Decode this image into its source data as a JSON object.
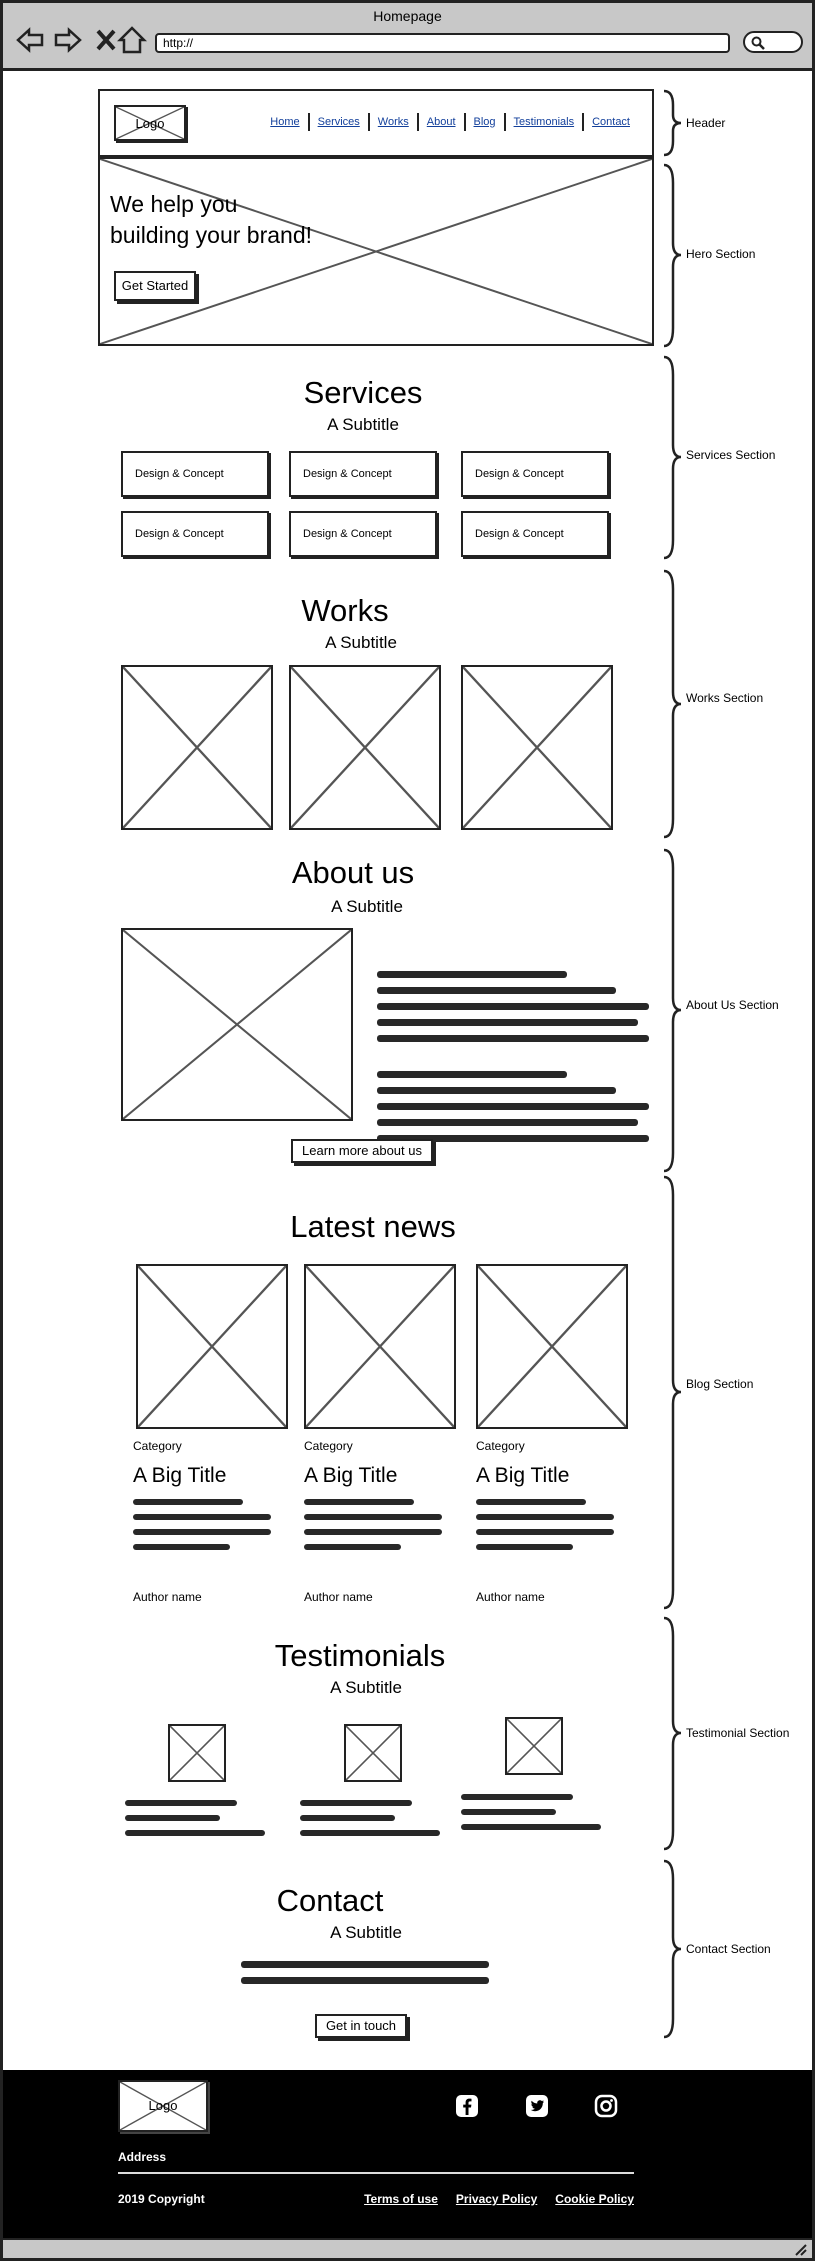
{
  "browser": {
    "title": "Homepage",
    "url": "http://"
  },
  "header": {
    "logo": "Logo",
    "nav": [
      "Home",
      "Services",
      "Works",
      "About",
      "Blog",
      "Testimonials",
      "Contact"
    ]
  },
  "hero": {
    "title_line1": "We help you",
    "title_line2": "building your brand!",
    "cta": "Get Started"
  },
  "services": {
    "title": "Services",
    "subtitle": "A Subtitle",
    "items": [
      "Design & Concept",
      "Design & Concept",
      "Design & Concept",
      "Design & Concept",
      "Design & Concept",
      "Design & Concept"
    ]
  },
  "works": {
    "title": "Works",
    "subtitle": "A Subtitle"
  },
  "about": {
    "title": "About us",
    "subtitle": "A Subtitle",
    "cta": "Learn more about us"
  },
  "blog": {
    "title": "Latest news",
    "posts": [
      {
        "category": "Category",
        "title": "A Big Title",
        "author": "Author name"
      },
      {
        "category": "Category",
        "title": "A Big Title",
        "author": "Author name"
      },
      {
        "category": "Category",
        "title": "A Big Title",
        "author": "Author name"
      }
    ]
  },
  "testimonials": {
    "title": "Testimonials",
    "subtitle": "A Subtitle"
  },
  "contact": {
    "title": "Contact",
    "subtitle": "A Subtitle",
    "cta": "Get in touch"
  },
  "footer": {
    "logo": "Logo",
    "address": "Address",
    "copyright": "2019 Copyright",
    "links": [
      "Terms of use",
      "Privacy Policy",
      "Cookie Policy"
    ],
    "social_icons": [
      "facebook-icon",
      "twitter-icon",
      "instagram-icon"
    ]
  },
  "annotations": [
    "Header",
    "Hero Section",
    "Services Section",
    "Works Section",
    "About Us Section",
    "Blog Section",
    "Testimonial Section",
    "Contact Section"
  ]
}
